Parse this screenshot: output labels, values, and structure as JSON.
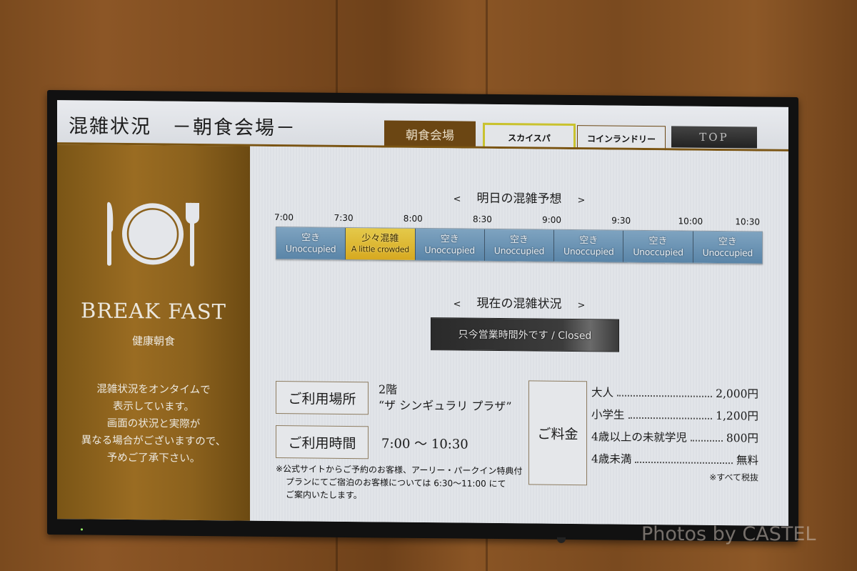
{
  "header": {
    "title": "混雑状況　－朝食会場－",
    "nav": [
      {
        "label": "朝食会場",
        "active": true
      },
      {
        "label": "スカイスパ",
        "highlighted": true
      },
      {
        "label": "コインランドリー"
      },
      {
        "label": "TOP"
      }
    ]
  },
  "sidebar": {
    "icon": "tableware-icon",
    "brand": "BREAK FAST",
    "brand_sub": "健康朝食",
    "notice_lines": [
      "混雑状況をオンタイムで",
      "表示しています。",
      "画面の状況と実際が",
      "異なる場合がございますので、",
      "予めご了承下さい。"
    ]
  },
  "forecast": {
    "prev": "<",
    "title": "明日の混雑予想",
    "next": ">",
    "times": [
      "7:00",
      "7:30",
      "8:00",
      "8:30",
      "9:00",
      "9:30",
      "10:00",
      "10:30"
    ],
    "slots": [
      {
        "jp": "空き",
        "en": "Unoccupied",
        "level": "unoccupied"
      },
      {
        "jp": "少々混雑",
        "en": "A little crowded",
        "level": "crowded"
      },
      {
        "jp": "空き",
        "en": "Unoccupied",
        "level": "unoccupied"
      },
      {
        "jp": "空き",
        "en": "Unoccupied",
        "level": "unoccupied"
      },
      {
        "jp": "空き",
        "en": "Unoccupied",
        "level": "unoccupied"
      },
      {
        "jp": "空き",
        "en": "Unoccupied",
        "level": "unoccupied"
      },
      {
        "jp": "空き",
        "en": "Unoccupied",
        "level": "unoccupied"
      }
    ],
    "colors": {
      "unoccupied": "#6b93b5",
      "crowded": "#ddb531"
    }
  },
  "current": {
    "prev": "<",
    "title": "現在の混雑状況",
    "next": ">",
    "status": "只今営業時間外です / Closed"
  },
  "info": {
    "location_label": "ご利用場所",
    "location_floor": "2階",
    "location_name": "“ザ シンギュラリ プラザ”",
    "hours_label": "ご利用時間",
    "hours_value": "7:00 〜 10:30",
    "footnote": [
      "※公式サイトからご予約のお客様、アーリー・パークイン特典付",
      "プランにてご宿泊のお客様については 6:30〜11:00 にて",
      "ご案内いたします。"
    ],
    "fee_label": "ご料金",
    "prices": [
      {
        "label": "大人",
        "value": "2,000円"
      },
      {
        "label": "小学生",
        "value": "1,200円"
      },
      {
        "label": "4歳以上の未就学児",
        "value": "800円"
      },
      {
        "label": "4歳未満",
        "value": "無料"
      }
    ],
    "tax_note": "※すべて税抜"
  },
  "watermark": "Photos by CASTEL"
}
